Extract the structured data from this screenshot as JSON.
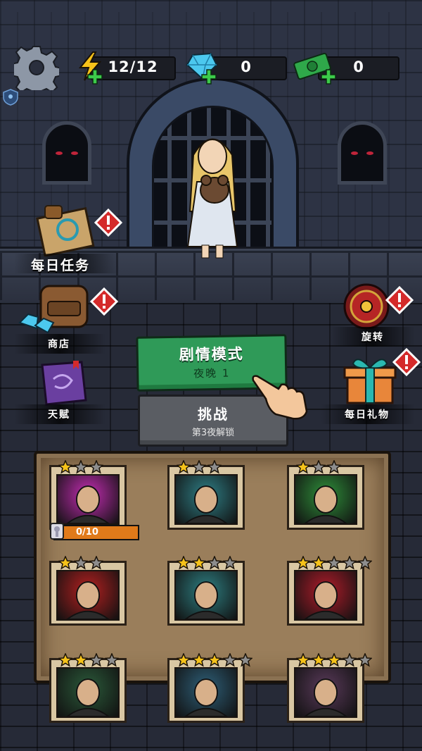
{
  "hud": {
    "energy": "12/12",
    "gems": "0",
    "cash": "0",
    "icons": [
      "gear-icon",
      "lightning-icon",
      "gem-icon",
      "cash-icon",
      "plus-icon",
      "shield-icon"
    ]
  },
  "menu": {
    "daily_tasks": "每日任务",
    "shop": "商店",
    "talent": "天赋",
    "spin": "旋转",
    "daily_gift": "每日礼物"
  },
  "story_button": {
    "title": "剧情模式",
    "subtitle": "夜晚 1"
  },
  "challenge_button": {
    "title": "挑战",
    "subtitle": "第3夜解锁"
  },
  "characters": [
    {
      "id": "girl",
      "stars": 1,
      "max_stars": 3,
      "progress": "0/10",
      "progress_value": 0,
      "bg": "#c42db3"
    },
    {
      "id": "miner",
      "stars": 1,
      "max_stars": 3,
      "bg": "#2f7f86"
    },
    {
      "id": "scientist",
      "stars": 1,
      "max_stars": 3,
      "bg": "#2f8f3a"
    },
    {
      "id": "priest",
      "stars": 1,
      "max_stars": 3,
      "bg": "#b52020"
    },
    {
      "id": "worker",
      "stars": 2,
      "max_stars": 4,
      "bg": "#2e7f82"
    },
    {
      "id": "robot",
      "stars": 2,
      "max_stars": 5,
      "bg": "#b01c2a"
    },
    {
      "id": "char7",
      "stars": 2,
      "max_stars": 4,
      "bg": "#2b5a3a"
    },
    {
      "id": "char8",
      "stars": 3,
      "max_stars": 5,
      "bg": "#2e5f78"
    },
    {
      "id": "char9",
      "stars": 3,
      "max_stars": 5,
      "bg": "#5a3a5a"
    }
  ],
  "colors": {
    "accent_green": "#2f9a58",
    "alert_red": "#d42a2a",
    "star_gold": "#f5c21a",
    "star_gray": "#8d8d8d",
    "progress_orange": "#e07a1a"
  }
}
